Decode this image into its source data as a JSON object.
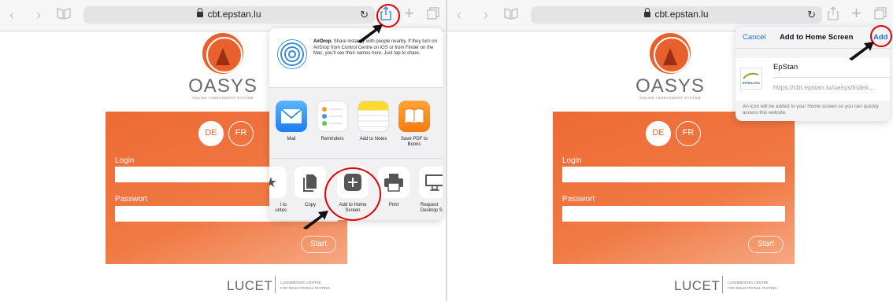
{
  "browser": {
    "url": "cbt.epstan.lu",
    "icons": [
      "back-icon",
      "forward-icon",
      "bookmarks-icon",
      "reload-icon",
      "share-icon",
      "new-tab-icon",
      "tabs-icon"
    ]
  },
  "page": {
    "brand": "OASYS",
    "tagline": "ONLINE ASSESSMENT SYSTEM",
    "lang_de": "DE",
    "lang_fr": "FR",
    "login_label": "Login",
    "password_label": "Passwort",
    "start_button": "Start",
    "footer_brand": "LUCET",
    "footer_line1": "LUXEMBOURG CENTRE",
    "footer_line2": "FOR EDUCATIONAL TESTING",
    "accent": "#e8612c"
  },
  "share_sheet": {
    "airdrop_bold": "AirDrop.",
    "airdrop_text": " Share instantly with people nearby. If they turn on AirDrop from Control Centre on iOS or from Finder on the Mac, you'll see their names here. Just tap to share.",
    "apps": [
      {
        "label": "Mail",
        "icon": "mail-icon"
      },
      {
        "label": "Reminders",
        "icon": "reminders-icon"
      },
      {
        "label": "Add to Notes",
        "icon": "notes-icon"
      },
      {
        "label": "Save PDF to Books",
        "icon": "books-icon"
      }
    ],
    "actions": [
      {
        "label": "Add to Favourites",
        "partial": "l to\nurites",
        "icon": "star-icon"
      },
      {
        "label": "Copy",
        "icon": "copy-icon"
      },
      {
        "label": "Add to Home Screen",
        "icon": "add-icon"
      },
      {
        "label": "Print",
        "icon": "print-icon"
      },
      {
        "label": "Request Desktop Site",
        "partial": "Request\nDesktop S",
        "icon": "desktop-icon"
      }
    ]
  },
  "add_home": {
    "cancel": "Cancel",
    "title": "Add to Home Screen",
    "add": "Add",
    "name": "EpStan",
    "url": "https://cbt.epstan.lu/oasys/index....",
    "note": "An icon will be added to your Home screen so you can quickly access this website.",
    "thumb_text": "ÉPREUVES"
  },
  "colors": {
    "highlight": "#e00000",
    "link": "#1a73e8"
  }
}
